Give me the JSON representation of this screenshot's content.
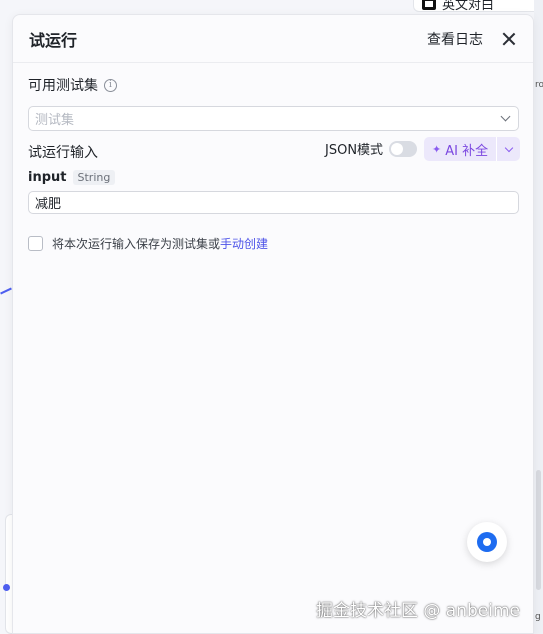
{
  "background": {
    "top_node_label": "英文对白",
    "edge_fragment_top": "ro",
    "edge_fragment_bottom": "g"
  },
  "panel": {
    "title": "试运行",
    "view_log_label": "查看日志",
    "test_set": {
      "label": "可用测试集",
      "info_icon": "info-circle-icon",
      "select_placeholder": "测试集"
    },
    "input_section": {
      "label": "试运行输入",
      "json_mode_label": "JSON模式",
      "json_mode_on": false,
      "ai_fill_label": "AI 补全",
      "fields": [
        {
          "name": "input",
          "type": "String",
          "value": "减肥"
        }
      ]
    },
    "save_option": {
      "checked": false,
      "text": "将本次运行输入保存为测试集或",
      "link_text": "手动创建"
    }
  },
  "watermark": "掘金技术社区 @ anbeime",
  "colors": {
    "accent": "#4d53e8",
    "ai_text": "#7b47e0",
    "ai_bg": "#ece8fb",
    "float_button": "#1e6cf0"
  }
}
